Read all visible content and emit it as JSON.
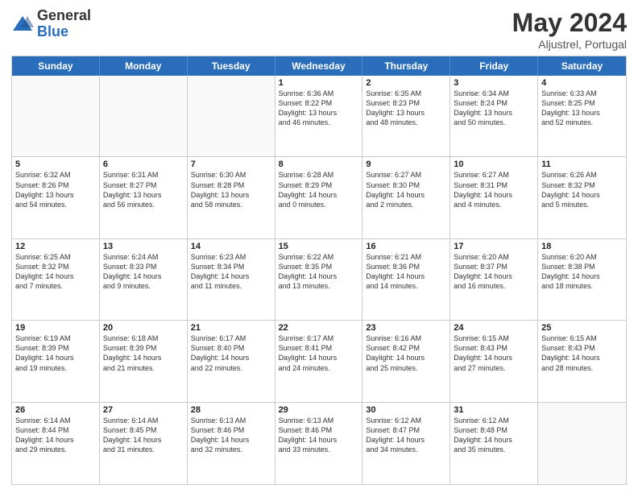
{
  "logo": {
    "general": "General",
    "blue": "Blue"
  },
  "header": {
    "month": "May 2024",
    "location": "Aljustrel, Portugal"
  },
  "days": [
    "Sunday",
    "Monday",
    "Tuesday",
    "Wednesday",
    "Thursday",
    "Friday",
    "Saturday"
  ],
  "weeks": [
    [
      {
        "date": "",
        "info": ""
      },
      {
        "date": "",
        "info": ""
      },
      {
        "date": "",
        "info": ""
      },
      {
        "date": "1",
        "info": "Sunrise: 6:36 AM\nSunset: 8:22 PM\nDaylight: 13 hours\nand 46 minutes."
      },
      {
        "date": "2",
        "info": "Sunrise: 6:35 AM\nSunset: 8:23 PM\nDaylight: 13 hours\nand 48 minutes."
      },
      {
        "date": "3",
        "info": "Sunrise: 6:34 AM\nSunset: 8:24 PM\nDaylight: 13 hours\nand 50 minutes."
      },
      {
        "date": "4",
        "info": "Sunrise: 6:33 AM\nSunset: 8:25 PM\nDaylight: 13 hours\nand 52 minutes."
      }
    ],
    [
      {
        "date": "5",
        "info": "Sunrise: 6:32 AM\nSunset: 8:26 PM\nDaylight: 13 hours\nand 54 minutes."
      },
      {
        "date": "6",
        "info": "Sunrise: 6:31 AM\nSunset: 8:27 PM\nDaylight: 13 hours\nand 56 minutes."
      },
      {
        "date": "7",
        "info": "Sunrise: 6:30 AM\nSunset: 8:28 PM\nDaylight: 13 hours\nand 58 minutes."
      },
      {
        "date": "8",
        "info": "Sunrise: 6:28 AM\nSunset: 8:29 PM\nDaylight: 14 hours\nand 0 minutes."
      },
      {
        "date": "9",
        "info": "Sunrise: 6:27 AM\nSunset: 8:30 PM\nDaylight: 14 hours\nand 2 minutes."
      },
      {
        "date": "10",
        "info": "Sunrise: 6:27 AM\nSunset: 8:31 PM\nDaylight: 14 hours\nand 4 minutes."
      },
      {
        "date": "11",
        "info": "Sunrise: 6:26 AM\nSunset: 8:32 PM\nDaylight: 14 hours\nand 5 minutes."
      }
    ],
    [
      {
        "date": "12",
        "info": "Sunrise: 6:25 AM\nSunset: 8:32 PM\nDaylight: 14 hours\nand 7 minutes."
      },
      {
        "date": "13",
        "info": "Sunrise: 6:24 AM\nSunset: 8:33 PM\nDaylight: 14 hours\nand 9 minutes."
      },
      {
        "date": "14",
        "info": "Sunrise: 6:23 AM\nSunset: 8:34 PM\nDaylight: 14 hours\nand 11 minutes."
      },
      {
        "date": "15",
        "info": "Sunrise: 6:22 AM\nSunset: 8:35 PM\nDaylight: 14 hours\nand 13 minutes."
      },
      {
        "date": "16",
        "info": "Sunrise: 6:21 AM\nSunset: 8:36 PM\nDaylight: 14 hours\nand 14 minutes."
      },
      {
        "date": "17",
        "info": "Sunrise: 6:20 AM\nSunset: 8:37 PM\nDaylight: 14 hours\nand 16 minutes."
      },
      {
        "date": "18",
        "info": "Sunrise: 6:20 AM\nSunset: 8:38 PM\nDaylight: 14 hours\nand 18 minutes."
      }
    ],
    [
      {
        "date": "19",
        "info": "Sunrise: 6:19 AM\nSunset: 8:39 PM\nDaylight: 14 hours\nand 19 minutes."
      },
      {
        "date": "20",
        "info": "Sunrise: 6:18 AM\nSunset: 8:39 PM\nDaylight: 14 hours\nand 21 minutes."
      },
      {
        "date": "21",
        "info": "Sunrise: 6:17 AM\nSunset: 8:40 PM\nDaylight: 14 hours\nand 22 minutes."
      },
      {
        "date": "22",
        "info": "Sunrise: 6:17 AM\nSunset: 8:41 PM\nDaylight: 14 hours\nand 24 minutes."
      },
      {
        "date": "23",
        "info": "Sunrise: 6:16 AM\nSunset: 8:42 PM\nDaylight: 14 hours\nand 25 minutes."
      },
      {
        "date": "24",
        "info": "Sunrise: 6:15 AM\nSunset: 8:43 PM\nDaylight: 14 hours\nand 27 minutes."
      },
      {
        "date": "25",
        "info": "Sunrise: 6:15 AM\nSunset: 8:43 PM\nDaylight: 14 hours\nand 28 minutes."
      }
    ],
    [
      {
        "date": "26",
        "info": "Sunrise: 6:14 AM\nSunset: 8:44 PM\nDaylight: 14 hours\nand 29 minutes."
      },
      {
        "date": "27",
        "info": "Sunrise: 6:14 AM\nSunset: 8:45 PM\nDaylight: 14 hours\nand 31 minutes."
      },
      {
        "date": "28",
        "info": "Sunrise: 6:13 AM\nSunset: 8:46 PM\nDaylight: 14 hours\nand 32 minutes."
      },
      {
        "date": "29",
        "info": "Sunrise: 6:13 AM\nSunset: 8:46 PM\nDaylight: 14 hours\nand 33 minutes."
      },
      {
        "date": "30",
        "info": "Sunrise: 6:12 AM\nSunset: 8:47 PM\nDaylight: 14 hours\nand 34 minutes."
      },
      {
        "date": "31",
        "info": "Sunrise: 6:12 AM\nSunset: 8:48 PM\nDaylight: 14 hours\nand 35 minutes."
      },
      {
        "date": "",
        "info": ""
      }
    ]
  ]
}
